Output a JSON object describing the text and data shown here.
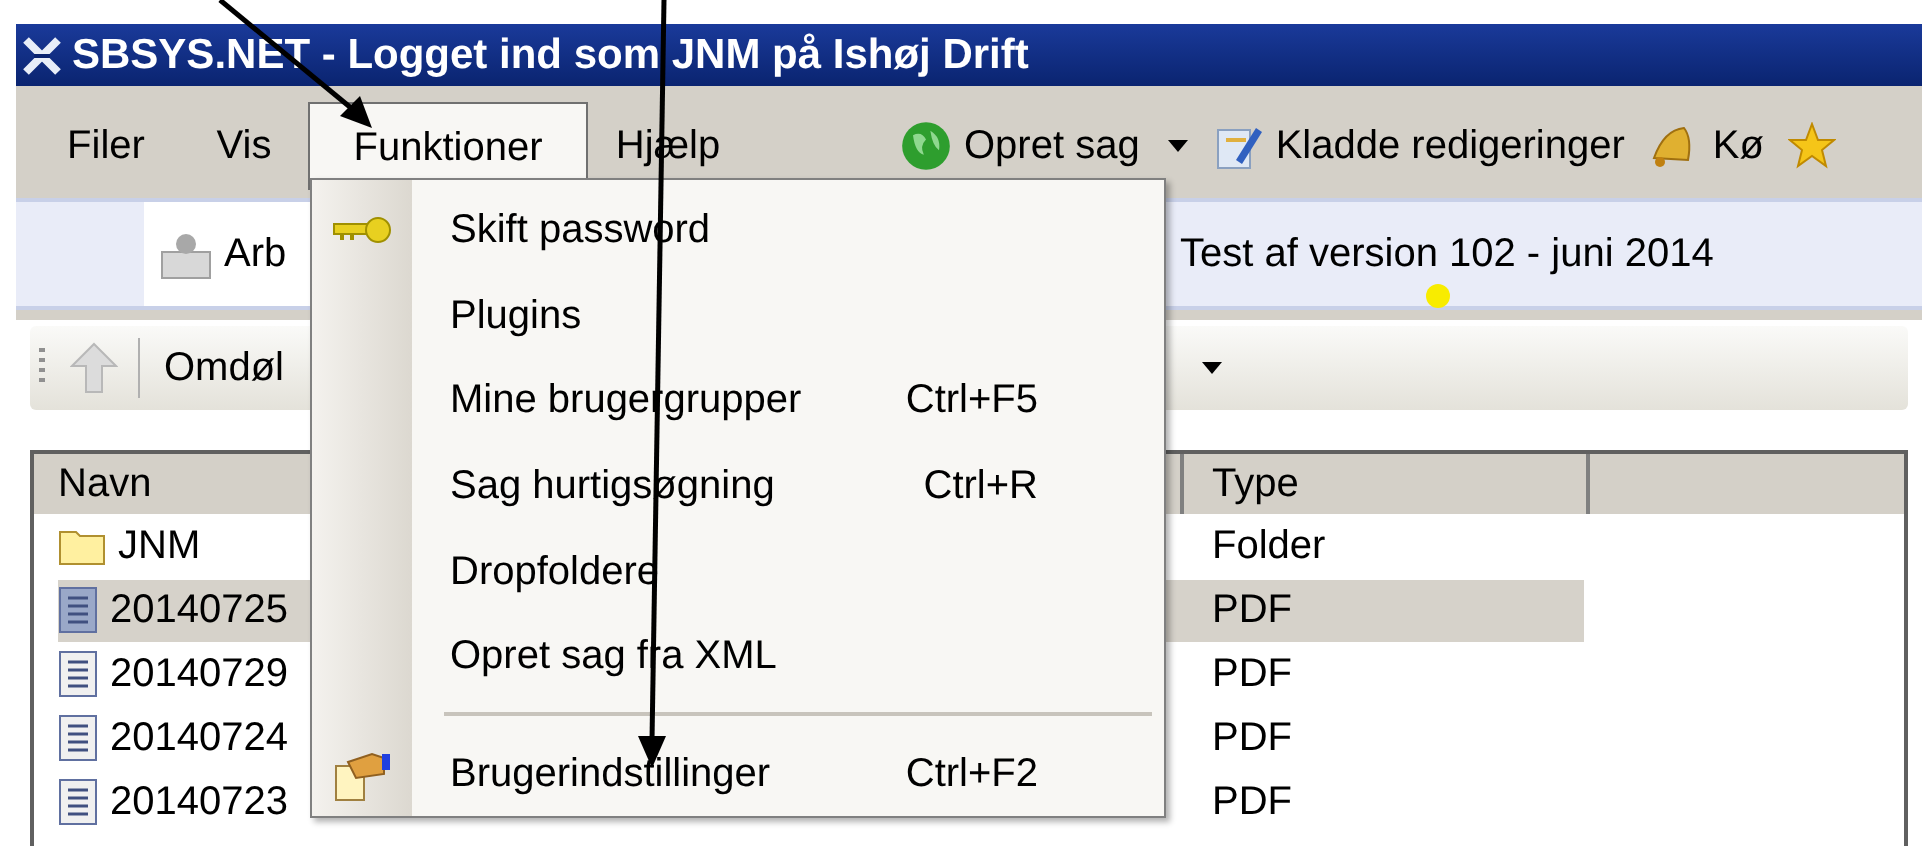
{
  "window": {
    "title": "SBSYS.NET - Logget ind som JNM på Ishøj Drift"
  },
  "menu_bar": [
    {
      "label": "Filer",
      "selected": false
    },
    {
      "label": "Vis",
      "selected": false
    },
    {
      "label": "Funktioner",
      "selected": true
    },
    {
      "label": "Hjælp",
      "selected": false
    }
  ],
  "toolbar": [
    {
      "kind": "globe",
      "label": "Opret sag",
      "dropdown": true
    },
    {
      "kind": "pencil",
      "label": "Kladde redigeringer",
      "dropdown": false
    },
    {
      "kind": "bell",
      "label": "Kø",
      "dropdown": false
    },
    {
      "kind": "star",
      "dropdown": false
    }
  ],
  "tab": {
    "label": "Arb"
  },
  "banner": "Test af version 102 - juni 2014",
  "nav_toolbar": {
    "button": "Omdøl"
  },
  "list": {
    "columns": [
      "Navn",
      "Type"
    ],
    "rows": [
      {
        "kind": "folder",
        "name": "JNM",
        "type": "Folder",
        "selected": false
      },
      {
        "kind": "file",
        "name": "20140725",
        "type": "PDF",
        "selected": true
      },
      {
        "kind": "file",
        "name": "20140729",
        "type": "PDF",
        "selected": false
      },
      {
        "kind": "file",
        "name": "20140724",
        "type": "PDF",
        "selected": false
      },
      {
        "kind": "file",
        "name": "20140723",
        "type": "PDF",
        "selected": false
      }
    ]
  },
  "dropdown_menu": {
    "items": [
      {
        "kind": "key",
        "label": "Skift password"
      },
      {
        "kind": "plain",
        "label": "Plugins"
      },
      {
        "kind": "plain",
        "label": "Mine brugergrupper",
        "shortcut": "Ctrl+F5"
      },
      {
        "kind": "plain",
        "label": "Sag hurtigsøgning",
        "shortcut": "Ctrl+R"
      },
      {
        "kind": "plain",
        "label": "Dropfoldere"
      },
      {
        "kind": "plain",
        "label": "Opret sag fra XML"
      },
      {
        "kind": "separator"
      },
      {
        "kind": "settings",
        "label": "Brugerindstillinger",
        "shortcut": "Ctrl+F2"
      }
    ]
  }
}
